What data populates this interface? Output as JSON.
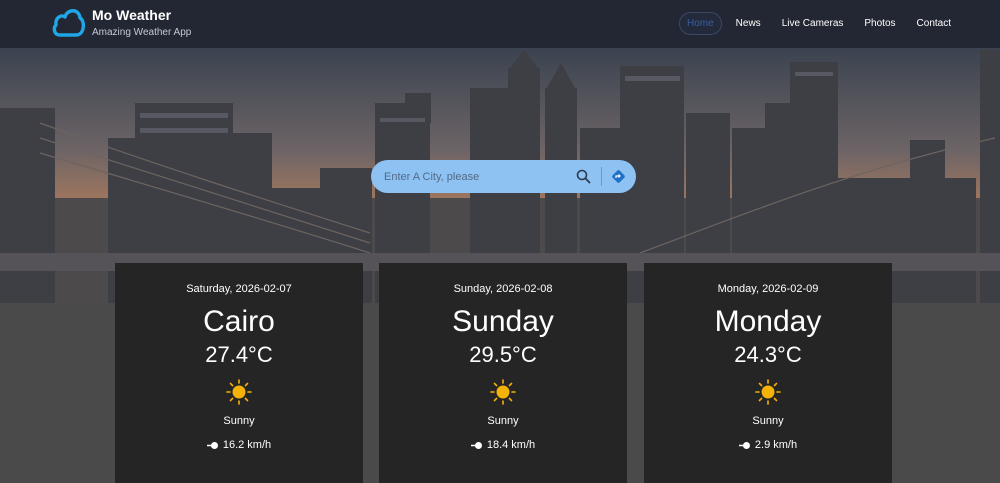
{
  "brand": {
    "title": "Mo Weather",
    "subtitle": "Amazing Weather App",
    "logo_icon": "cloud-icon"
  },
  "nav": {
    "items": [
      {
        "label": "Home",
        "active": true
      },
      {
        "label": "News",
        "active": false
      },
      {
        "label": "Live Cameras",
        "active": false
      },
      {
        "label": "Photos",
        "active": false
      },
      {
        "label": "Contact",
        "active": false
      }
    ]
  },
  "search": {
    "placeholder": "Enter A City, please",
    "value": "",
    "search_icon": "search-icon",
    "location_icon": "location-arrow-icon"
  },
  "forecast": [
    {
      "date": "Saturday, 2026-02-07",
      "title": "Cairo",
      "temp": "27.4°C",
      "condition": "Sunny",
      "wind": "16.2 km/h",
      "icon": "sun-icon"
    },
    {
      "date": "Sunday, 2026-02-08",
      "title": "Sunday",
      "temp": "29.5°C",
      "condition": "Sunny",
      "wind": "18.4 km/h",
      "icon": "sun-icon"
    },
    {
      "date": "Monday, 2026-02-09",
      "title": "Monday",
      "temp": "24.3°C",
      "condition": "Sunny",
      "wind": "2.9 km/h",
      "icon": "sun-icon"
    }
  ],
  "colors": {
    "navbar": "#222733",
    "card": "#252525",
    "search": "#8dc2f3",
    "sun": "#f5b30a",
    "background": "#4a4a4a"
  }
}
